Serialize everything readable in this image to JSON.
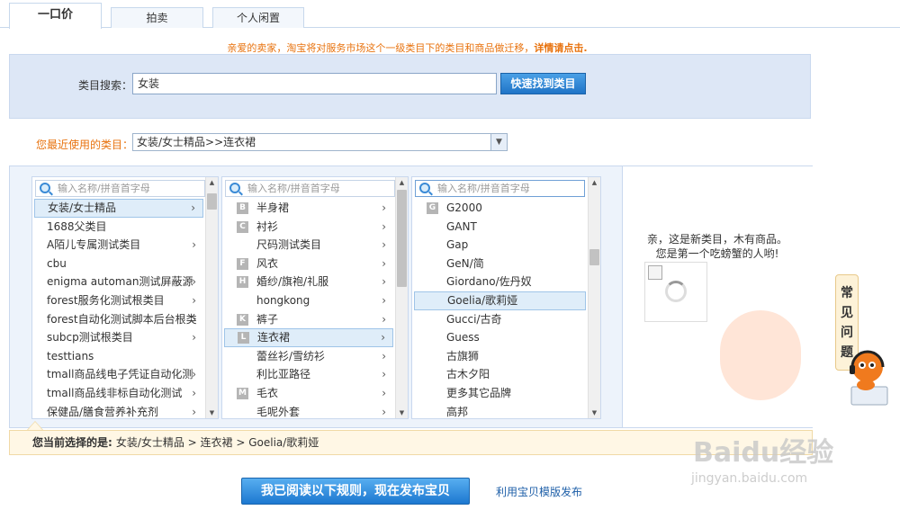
{
  "tabs": [
    {
      "label": "一口价",
      "active": true
    },
    {
      "label": "拍卖",
      "active": false
    },
    {
      "label": "个人闲置",
      "active": false
    }
  ],
  "notice": {
    "text": "亲爱的卖家，淘宝将对服务市场这个一级类目下的类目和商品做迁移，",
    "link": "详情请点击."
  },
  "search": {
    "label": "类目搜索：",
    "value": "女装",
    "button": "快速找到类目"
  },
  "recent": {
    "label": "您最近使用的类目：",
    "value": "女装/女士精品>>连衣裙"
  },
  "columns": [
    {
      "placeholder": "输入名称/拼音首字母",
      "items": [
        {
          "label": "女装/女士精品",
          "arrow": true,
          "selected": true
        },
        {
          "label": "1688父类目",
          "arrow": false
        },
        {
          "label": "A陌儿专属测试类目",
          "arrow": true
        },
        {
          "label": "cbu",
          "arrow": false
        },
        {
          "label": "enigma automan测试屏蔽源",
          "arrow": true
        },
        {
          "label": "forest服务化测试根类目",
          "arrow": true
        },
        {
          "label": "forest自动化测试脚本后台根类",
          "arrow": true
        },
        {
          "label": "subcp测试根类目",
          "arrow": true
        },
        {
          "label": "testtians",
          "arrow": false
        },
        {
          "label": "tmall商品线电子凭证自动化测",
          "arrow": true
        },
        {
          "label": "tmall商品线非标自动化测试",
          "arrow": true
        },
        {
          "label": "保健品/膳食营养补充剂",
          "arrow": true
        }
      ]
    },
    {
      "placeholder": "输入名称/拼音首字母",
      "items": [
        {
          "letter": "B",
          "label": "半身裙",
          "arrow": true
        },
        {
          "letter": "C",
          "label": "衬衫",
          "arrow": true
        },
        {
          "letter": "",
          "label": "尺码测试类目",
          "arrow": true
        },
        {
          "letter": "F",
          "label": "风衣",
          "arrow": true
        },
        {
          "letter": "H",
          "label": "婚纱/旗袍/礼服",
          "arrow": true
        },
        {
          "letter": "",
          "label": "hongkong",
          "arrow": true
        },
        {
          "letter": "K",
          "label": "裤子",
          "arrow": true
        },
        {
          "letter": "L",
          "label": "连衣裙",
          "arrow": true,
          "selected": true
        },
        {
          "letter": "",
          "label": "蕾丝衫/雪纺衫",
          "arrow": true
        },
        {
          "letter": "",
          "label": "利比亚路径",
          "arrow": true
        },
        {
          "letter": "M",
          "label": "毛衣",
          "arrow": true
        },
        {
          "letter": "",
          "label": "毛呢外套",
          "arrow": true
        }
      ]
    },
    {
      "placeholder": "输入名称/拼音首字母",
      "items": [
        {
          "letter": "G",
          "label": "G2000"
        },
        {
          "letter": "",
          "label": "GANT"
        },
        {
          "letter": "",
          "label": "Gap"
        },
        {
          "letter": "",
          "label": "GeN/简"
        },
        {
          "letter": "",
          "label": "Giordano/佐丹奴"
        },
        {
          "letter": "",
          "label": "Goelia/歌莉娅",
          "selected": true
        },
        {
          "letter": "",
          "label": "Gucci/古奇"
        },
        {
          "letter": "",
          "label": "Guess"
        },
        {
          "letter": "",
          "label": "古旗狮"
        },
        {
          "letter": "",
          "label": "古木夕阳"
        },
        {
          "letter": "",
          "label": "更多其它品牌"
        },
        {
          "letter": "",
          "label": "高邦"
        }
      ]
    }
  ],
  "info": {
    "line1": "亲，这是新类目，木有商品。",
    "line2": "您是第一个吃螃蟹的人哟!"
  },
  "faq": [
    "常",
    "见",
    "问",
    "题"
  ],
  "selected": {
    "label": "您当前选择的是:",
    "path": "女装/女士精品 > 连衣裙 > Goelia/歌莉娅"
  },
  "publish_button": "我已阅读以下规则，现在发布宝贝",
  "template_link": "利用宝贝模版发布",
  "watermark": {
    "logo": "Baidu经验",
    "url": "jingyan.baidu.com"
  },
  "colors": {
    "accent": "#1d78d0",
    "notice": "#e8730f",
    "panel": "#dde7f6"
  }
}
